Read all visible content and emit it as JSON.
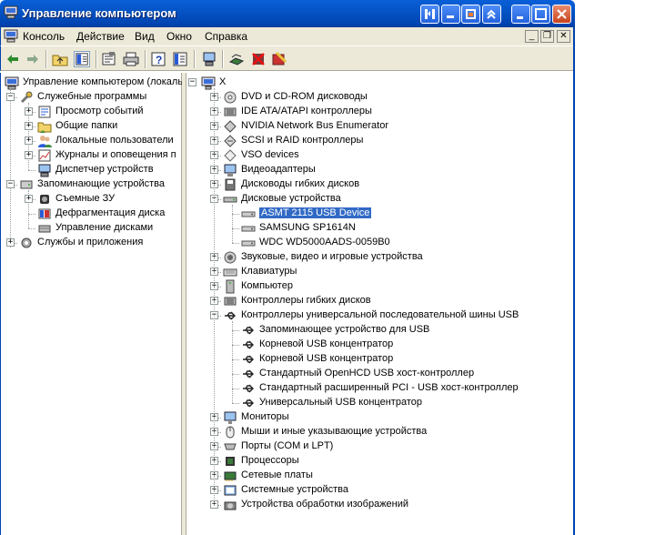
{
  "window": {
    "title": "Управление компьютером"
  },
  "menu": {
    "items": [
      "Консоль",
      "Действие",
      "Вид",
      "Окно",
      "Справка"
    ]
  },
  "toolbar": {
    "icons": [
      "back-arrow-icon",
      "forward-arrow-icon",
      "up-folder-icon",
      "show-hide-tree-icon",
      "properties-icon",
      "print-icon",
      "help-icon",
      "export-icon",
      "scan-hardware-icon",
      "update-driver-icon",
      "disable-device-icon",
      "uninstall-device-icon"
    ]
  },
  "left_tree": {
    "root": "Управление компьютером (локаль",
    "groups": [
      {
        "label": "Служебные программы",
        "children": [
          "Просмотр событий",
          "Общие папки",
          "Локальные пользователи",
          "Журналы и оповещения п",
          "Диспетчер устройств"
        ]
      },
      {
        "label": "Запоминающие устройства",
        "children": [
          "Съемные ЗУ",
          "Дефрагментация диска",
          "Управление дисками"
        ]
      },
      {
        "label": "Службы и приложения",
        "children": []
      }
    ]
  },
  "device_tree": {
    "computer": "X",
    "categories": [
      {
        "label": "DVD и CD-ROM дисководы",
        "icon": "dvd-drive-icon",
        "expanded": false
      },
      {
        "label": "IDE ATA/ATAPI контроллеры",
        "icon": "ide-controller-icon",
        "expanded": false
      },
      {
        "label": "NVIDIA Network Bus Enumerator",
        "icon": "network-enumerator-icon",
        "expanded": false
      },
      {
        "label": "SCSI и RAID контроллеры",
        "icon": "scsi-controller-icon",
        "expanded": false
      },
      {
        "label": "VSO devices",
        "icon": "vso-device-icon",
        "expanded": false
      },
      {
        "label": "Видеоадаптеры",
        "icon": "video-adapter-icon",
        "expanded": false
      },
      {
        "label": "Дисководы гибких дисков",
        "icon": "floppy-drive-icon",
        "expanded": false
      },
      {
        "label": "Дисковые устройства",
        "icon": "disk-drive-icon",
        "expanded": true,
        "children": [
          "ASMT 2115 USB Device",
          "SAMSUNG SP1614N",
          "WDC WD5000AADS-0059B0"
        ]
      },
      {
        "label": "Звуковые, видео и игровые устройства",
        "icon": "sound-icon",
        "expanded": false
      },
      {
        "label": "Клавиатуры",
        "icon": "keyboard-icon",
        "expanded": false
      },
      {
        "label": "Компьютер",
        "icon": "computer-icon",
        "expanded": false
      },
      {
        "label": "Контроллеры гибких дисков",
        "icon": "floppy-controller-icon",
        "expanded": false
      },
      {
        "label": "Контроллеры универсальной последовательной шины USB",
        "icon": "usb-icon",
        "expanded": true,
        "children": [
          "Запоминающее устройство для USB",
          "Корневой USB концентратор",
          "Корневой USB концентратор",
          "Стандартный OpenHCD USB хост-контроллер",
          "Стандартный расширенный PCI - USB хост-контроллер",
          "Универсальный USB концентратор"
        ]
      },
      {
        "label": "Мониторы",
        "icon": "monitor-icon",
        "expanded": false
      },
      {
        "label": "Мыши и иные указывающие устройства",
        "icon": "mouse-icon",
        "expanded": false
      },
      {
        "label": "Порты (COM и LPT)",
        "icon": "port-icon",
        "expanded": false
      },
      {
        "label": "Процессоры",
        "icon": "processor-icon",
        "expanded": false
      },
      {
        "label": "Сетевые платы",
        "icon": "network-card-icon",
        "expanded": false
      },
      {
        "label": "Системные устройства",
        "icon": "system-device-icon",
        "expanded": false
      },
      {
        "label": "Устройства обработки изображений",
        "icon": "imaging-device-icon",
        "expanded": false
      }
    ]
  },
  "selection": {
    "left": "Диспетчер устройств",
    "right": "ASMT 2115 USB Device",
    "highlight_color": "#316ac5"
  }
}
